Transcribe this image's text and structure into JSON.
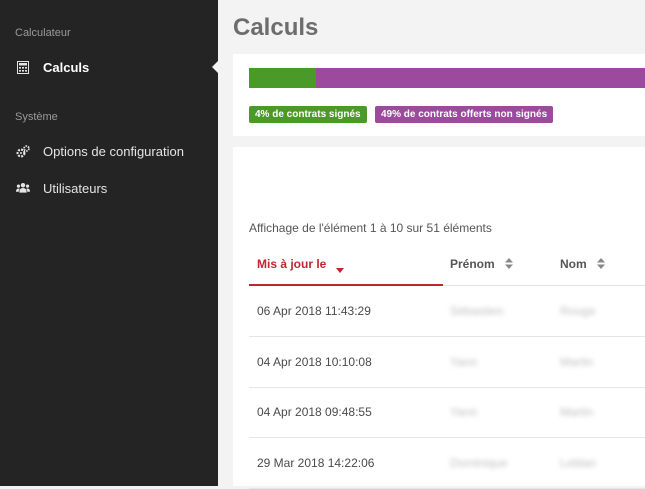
{
  "sidebar": {
    "sections": [
      {
        "label": "Calculateur",
        "items": [
          {
            "label": "Calculs",
            "icon": "calculator-icon",
            "active": true
          }
        ]
      },
      {
        "label": "Système",
        "items": [
          {
            "label": "Options de configuration",
            "icon": "gears-icon",
            "active": false
          },
          {
            "label": "Utilisateurs",
            "icon": "users-icon",
            "active": false
          }
        ]
      }
    ]
  },
  "page": {
    "title": "Calculs"
  },
  "progress": {
    "signed_fraction": 0.17,
    "signed_label": "4% de contrats signés",
    "offered_label": "49% de contrats offerts non signés",
    "colors": {
      "signed": "#4a9a2a",
      "offered": "#9b4a9e"
    }
  },
  "table": {
    "info": "Affichage de l'élément 1 à 10 sur 51 éléments",
    "columns": [
      {
        "label": "Mis à jour le",
        "sorted": true,
        "sort_dir": "desc"
      },
      {
        "label": "Prénom",
        "sorted": false
      },
      {
        "label": "Nom",
        "sorted": false
      }
    ],
    "rows": [
      {
        "updated": "06 Apr 2018 11:43:29",
        "first": "Sébastien",
        "last": "Rouge"
      },
      {
        "updated": "04 Apr 2018 10:10:08",
        "first": "Yann",
        "last": "Martin"
      },
      {
        "updated": "04 Apr 2018 09:48:55",
        "first": "Yann",
        "last": "Martin"
      },
      {
        "updated": "29 Mar 2018 14:22:06",
        "first": "Dominique",
        "last": "Leblan"
      }
    ],
    "accent_color": "#c0262d"
  }
}
